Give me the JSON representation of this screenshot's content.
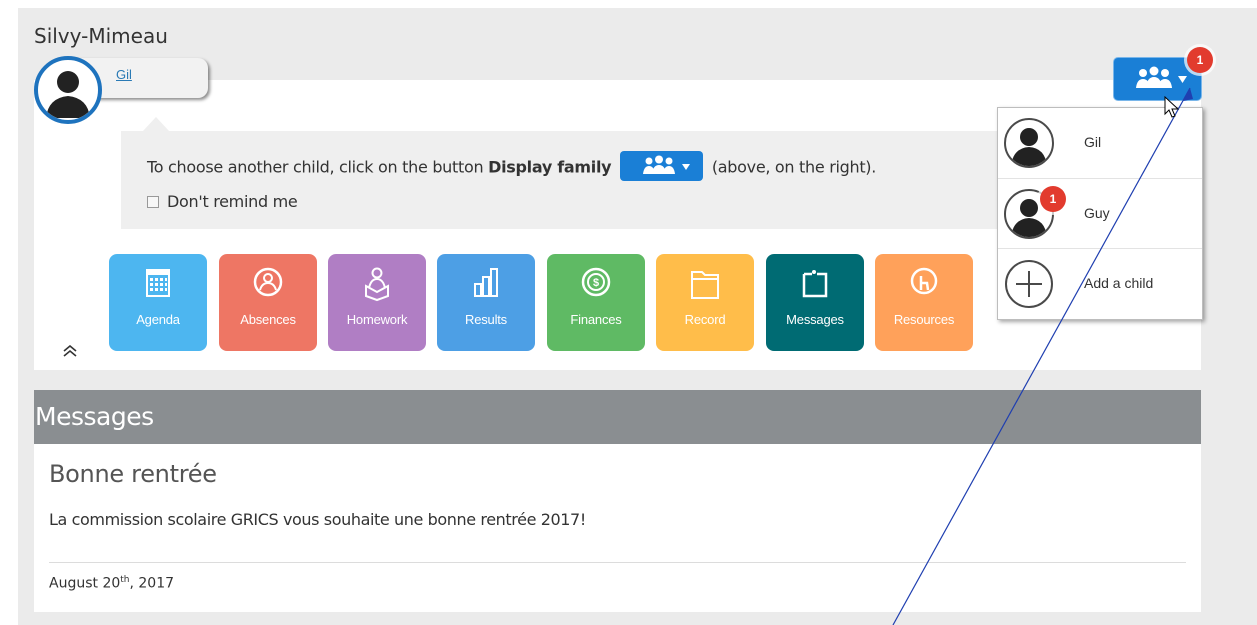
{
  "school": {
    "name": "Silvy-Mimeau"
  },
  "selected_child": {
    "name": "Gil"
  },
  "reminder": {
    "text_before": "To choose another child, click on the button ",
    "bold": "Display family",
    "text_after": "(above, on the right).",
    "checkbox_label": "Don't remind me"
  },
  "tiles": [
    {
      "label": "Agenda",
      "color": "#4db6f0",
      "icon": "calendar-icon"
    },
    {
      "label": "Absences",
      "color": "#ee7664",
      "icon": "person-circle-icon"
    },
    {
      "label": "Homework",
      "color": "#b07ec4",
      "icon": "student-reading-icon"
    },
    {
      "label": "Results",
      "color": "#4d9fe5",
      "icon": "bar-chart-icon"
    },
    {
      "label": "Finances",
      "color": "#5fba64",
      "icon": "dollar-coin-icon"
    },
    {
      "label": "Record",
      "color": "#ffbd4a",
      "icon": "folder-icon"
    },
    {
      "label": "Messages",
      "color": "#006b73",
      "icon": "note-icon"
    },
    {
      "label": "Resources",
      "color": "#ffa15a",
      "icon": "touch-hand-icon"
    }
  ],
  "messages": {
    "header": "Messages",
    "title": "Bonne rentrée",
    "body": "La commission scolaire GRICS vous souhaite une bonne rentrée 2017!",
    "date_day": "August 20",
    "date_suffix": "th",
    "date_year": ", 2017"
  },
  "family_button": {
    "badge": "1"
  },
  "dropdown": {
    "items": [
      {
        "label": "Gil"
      },
      {
        "label": "Guy",
        "badge": "1"
      },
      {
        "label": "Add a child"
      }
    ]
  },
  "colors": {
    "primary": "#1a7fd6",
    "badge": "#e23b2e",
    "header_gray": "#8a8e91"
  }
}
